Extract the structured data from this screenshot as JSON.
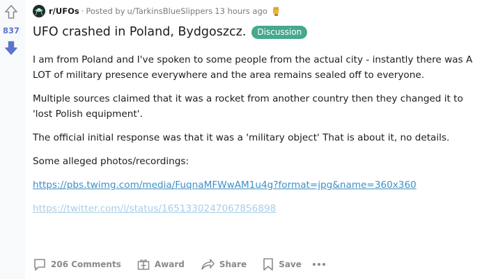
{
  "vote": {
    "count": "837"
  },
  "meta": {
    "subreddit": "r/UFOs",
    "separator": "·",
    "posted_by": "Posted by",
    "user": "u/TarkinsBlueSlippers",
    "time": "13 hours ago"
  },
  "post": {
    "title": "UFO crashed in Poland, Bydgoszcz.",
    "flair": "Discussion",
    "paragraphs": [
      "I am from Poland and I've spoken to some people from the actual city - instantly there was A LOT of military presence everywhere and the area remains sealed off to everyone.",
      "Multiple sources claimed that it was a rocket from another country then they changed it to 'lost Polish equipment'.",
      "The official initial response was that it was a 'military object' That is about it, no details.",
      "Some alleged photos/recordings:"
    ],
    "links": [
      "https://pbs.twimg.com/media/FuqnaMFWwAM1u4g?format=jpg&name=360x360",
      "https://twitter.com/i/status/1651330247067856898"
    ]
  },
  "actions": {
    "comments": "206 Comments",
    "award": "Award",
    "share": "Share",
    "save": "Save"
  },
  "colors": {
    "accent": "#5a75cc",
    "flair": "#46a88c",
    "link": "#3d8fc6",
    "muted": "#878a8c"
  }
}
